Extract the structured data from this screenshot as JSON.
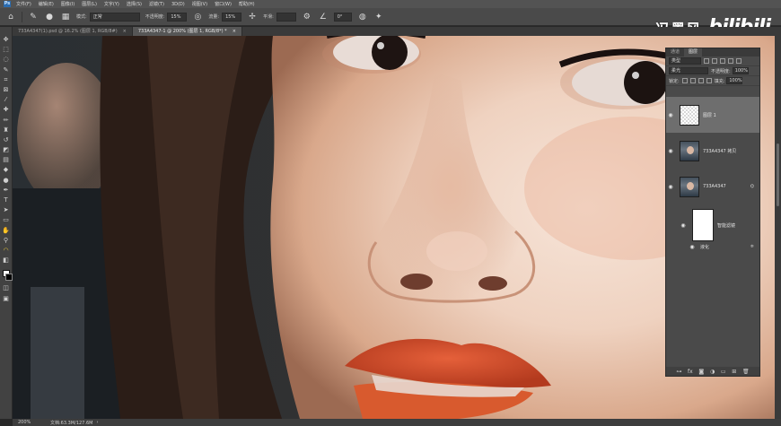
{
  "menu": {
    "items": [
      "文件(F)",
      "编辑(E)",
      "图像(I)",
      "图层(L)",
      "文字(Y)",
      "选择(S)",
      "滤镜(T)",
      "3D(D)",
      "视图(V)",
      "窗口(W)",
      "帮助(H)"
    ]
  },
  "options": {
    "mode_label": "模式:",
    "mode_value": "正常",
    "opacity_label": "不透明度:",
    "opacity_value": "15%",
    "flow_label": "流量:",
    "flow_value": "15%",
    "smoothing_label": "平滑:",
    "angle_value": "0°"
  },
  "watermark": {
    "author": "冯墨风",
    "brand": "bilibili"
  },
  "tabs": [
    {
      "label": "733A4347(1).psd @ 16.2% (图层 1, RGB/8#)"
    },
    {
      "label": "733A4347-1 @ 200% (图层 1, RGB/8*) *"
    }
  ],
  "status": {
    "zoom": "200%",
    "docsize": "文档:63.3M/127.6M"
  },
  "layers_panel": {
    "tabs": [
      "通道",
      "图层"
    ],
    "filter_kind": "类型",
    "blend_mode": "柔光",
    "opacity_label": "不透明度:",
    "opacity_value": "100%",
    "lock_label": "锁定:",
    "fill_label": "填充:",
    "fill_value": "100%",
    "layers": [
      {
        "name": "图层 1"
      },
      {
        "name": "733A4347 拷贝"
      },
      {
        "name": "733A4347"
      },
      {
        "name": "智能滤镜"
      },
      {
        "name": "液化"
      }
    ]
  },
  "colors": {
    "accent_selected_layer": "#6e6e6e",
    "panel_bg": "#4a4a4a",
    "app_bg": "#282828"
  }
}
